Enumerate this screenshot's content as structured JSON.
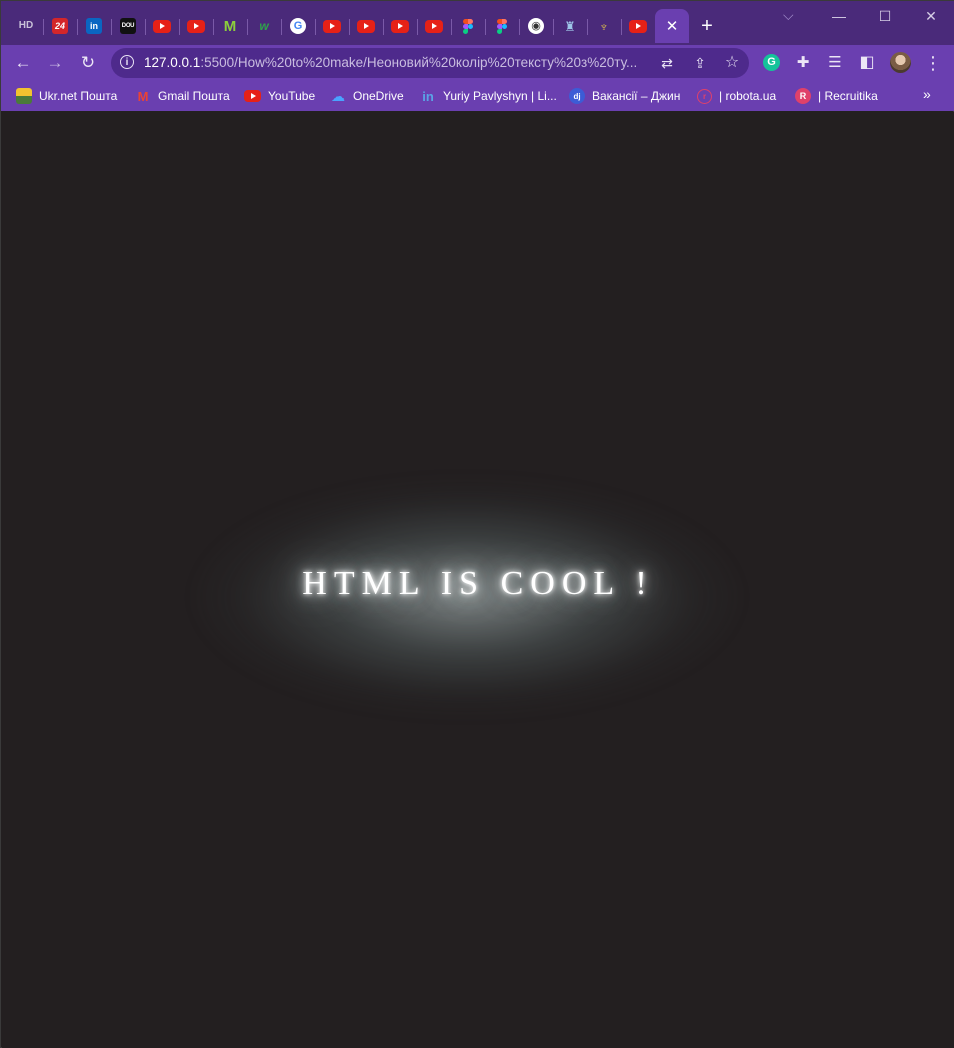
{
  "browser": {
    "tabs": [
      {
        "icon": "hd-icon",
        "glyph": "HD"
      },
      {
        "icon": "news24-icon",
        "glyph": "24"
      },
      {
        "icon": "linkedin-icon",
        "glyph": "in"
      },
      {
        "icon": "dou-icon",
        "glyph": "DOU"
      },
      {
        "icon": "youtube-icon",
        "glyph": ""
      },
      {
        "icon": "youtube-icon",
        "glyph": ""
      },
      {
        "icon": "m-logo-icon",
        "glyph": "M"
      },
      {
        "icon": "w-logo-icon",
        "glyph": "w"
      },
      {
        "icon": "google-icon",
        "glyph": "G"
      },
      {
        "icon": "youtube-icon",
        "glyph": ""
      },
      {
        "icon": "youtube-icon",
        "glyph": ""
      },
      {
        "icon": "youtube-icon",
        "glyph": ""
      },
      {
        "icon": "youtube-icon",
        "glyph": ""
      },
      {
        "icon": "figma-icon",
        "glyph": ""
      },
      {
        "icon": "figma-icon",
        "glyph": ""
      },
      {
        "icon": "globe-icon",
        "glyph": "◉"
      },
      {
        "icon": "gov-icon",
        "glyph": "♜"
      },
      {
        "icon": "ua-emblem-icon",
        "glyph": "♆"
      },
      {
        "icon": "youtube-icon",
        "glyph": ""
      }
    ],
    "active_tab_close": "✕",
    "new_tab": "+",
    "tab_search": "⌵",
    "window_controls": {
      "minimize": "—",
      "maximize": "☐",
      "close": "✕"
    },
    "nav": {
      "back": "←",
      "forward": "→",
      "reload": "↻"
    },
    "url_host": "127.0.0.1",
    "url_path": ":5500/How%20to%20make/Неоновий%20колір%20тексту%20з%20ту...",
    "omnibox_icons": {
      "translate": "⇄",
      "share": "⇪",
      "bookmark": "☆"
    },
    "toolbar_icons": {
      "grammarly": "G",
      "extensions": "✚",
      "reading_list": "☰",
      "side_panel": "◧",
      "menu": "⋮"
    },
    "bookmarks": [
      {
        "label": "Ukr.net Пошта",
        "icon": "ukrnet-icon",
        "glyph": ""
      },
      {
        "label": "Gmail Пошта",
        "icon": "gmail-icon",
        "glyph": "M"
      },
      {
        "label": "YouTube",
        "icon": "youtube-icon",
        "glyph": ""
      },
      {
        "label": "OneDrive",
        "icon": "onedrive-icon",
        "glyph": "☁"
      },
      {
        "label": "Yuriy Pavlyshyn | Li...",
        "icon": "linkedin-icon",
        "glyph": "in"
      },
      {
        "label": "Вакансії – Джин",
        "icon": "djinni-icon",
        "glyph": "dj"
      },
      {
        "label": "| robota.ua",
        "icon": "robota-icon",
        "glyph": "r"
      },
      {
        "label": "| Recruitika",
        "icon": "recruitika-icon",
        "glyph": "R"
      }
    ],
    "bookmarks_more": "»"
  },
  "page": {
    "heading": "HTML IS COOL !",
    "background_color": "#231f20",
    "text_color": "#ffffff"
  }
}
